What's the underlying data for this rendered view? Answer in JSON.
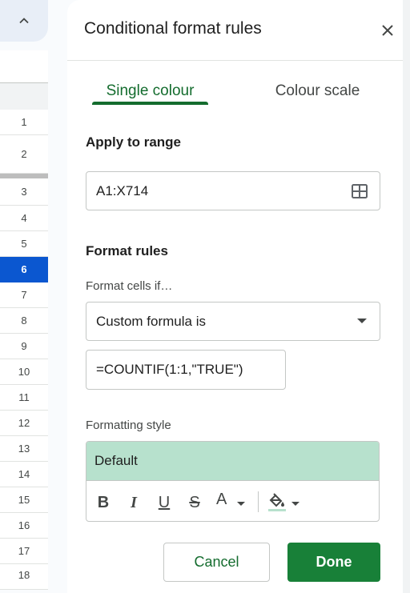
{
  "sheet": {
    "rows": [
      {
        "label": "1"
      },
      {
        "label": "2"
      },
      {
        "label": "3"
      },
      {
        "label": "4"
      },
      {
        "label": "5"
      },
      {
        "label": "6",
        "selected": true
      },
      {
        "label": "7"
      },
      {
        "label": "8"
      },
      {
        "label": "9"
      },
      {
        "label": "10"
      },
      {
        "label": "11"
      },
      {
        "label": "12"
      },
      {
        "label": "13"
      },
      {
        "label": "14"
      },
      {
        "label": "15"
      },
      {
        "label": "16"
      },
      {
        "label": "17"
      },
      {
        "label": "18"
      }
    ],
    "collapse_icon": "chevron-up-icon"
  },
  "panel": {
    "title": "Conditional format rules",
    "close_icon": "close-icon",
    "tabs": [
      {
        "label": "Single colour",
        "active": true
      },
      {
        "label": "Colour scale",
        "active": false
      }
    ],
    "apply_to_range": {
      "label": "Apply to range",
      "value": "A1:X714",
      "icon": "grid-icon"
    },
    "format_rules": {
      "label": "Format rules",
      "condition_label": "Format cells if…",
      "condition_value": "Custom formula is",
      "formula_value": "=COUNTIF(1:1,\"TRUE\")"
    },
    "formatting_style": {
      "label": "Formatting style",
      "preview_text": "Default",
      "preview_color": "#b7e1cd",
      "tools": {
        "bold": "B",
        "italic": "I",
        "underline": "U",
        "strikethrough": "S",
        "text_color": "A"
      },
      "fill_icon": "paint-bucket-icon"
    },
    "buttons": {
      "cancel": "Cancel",
      "done": "Done"
    }
  },
  "colors": {
    "accent": "#146c2e",
    "done_button": "#188038",
    "selected_row": "#0b57d0"
  }
}
